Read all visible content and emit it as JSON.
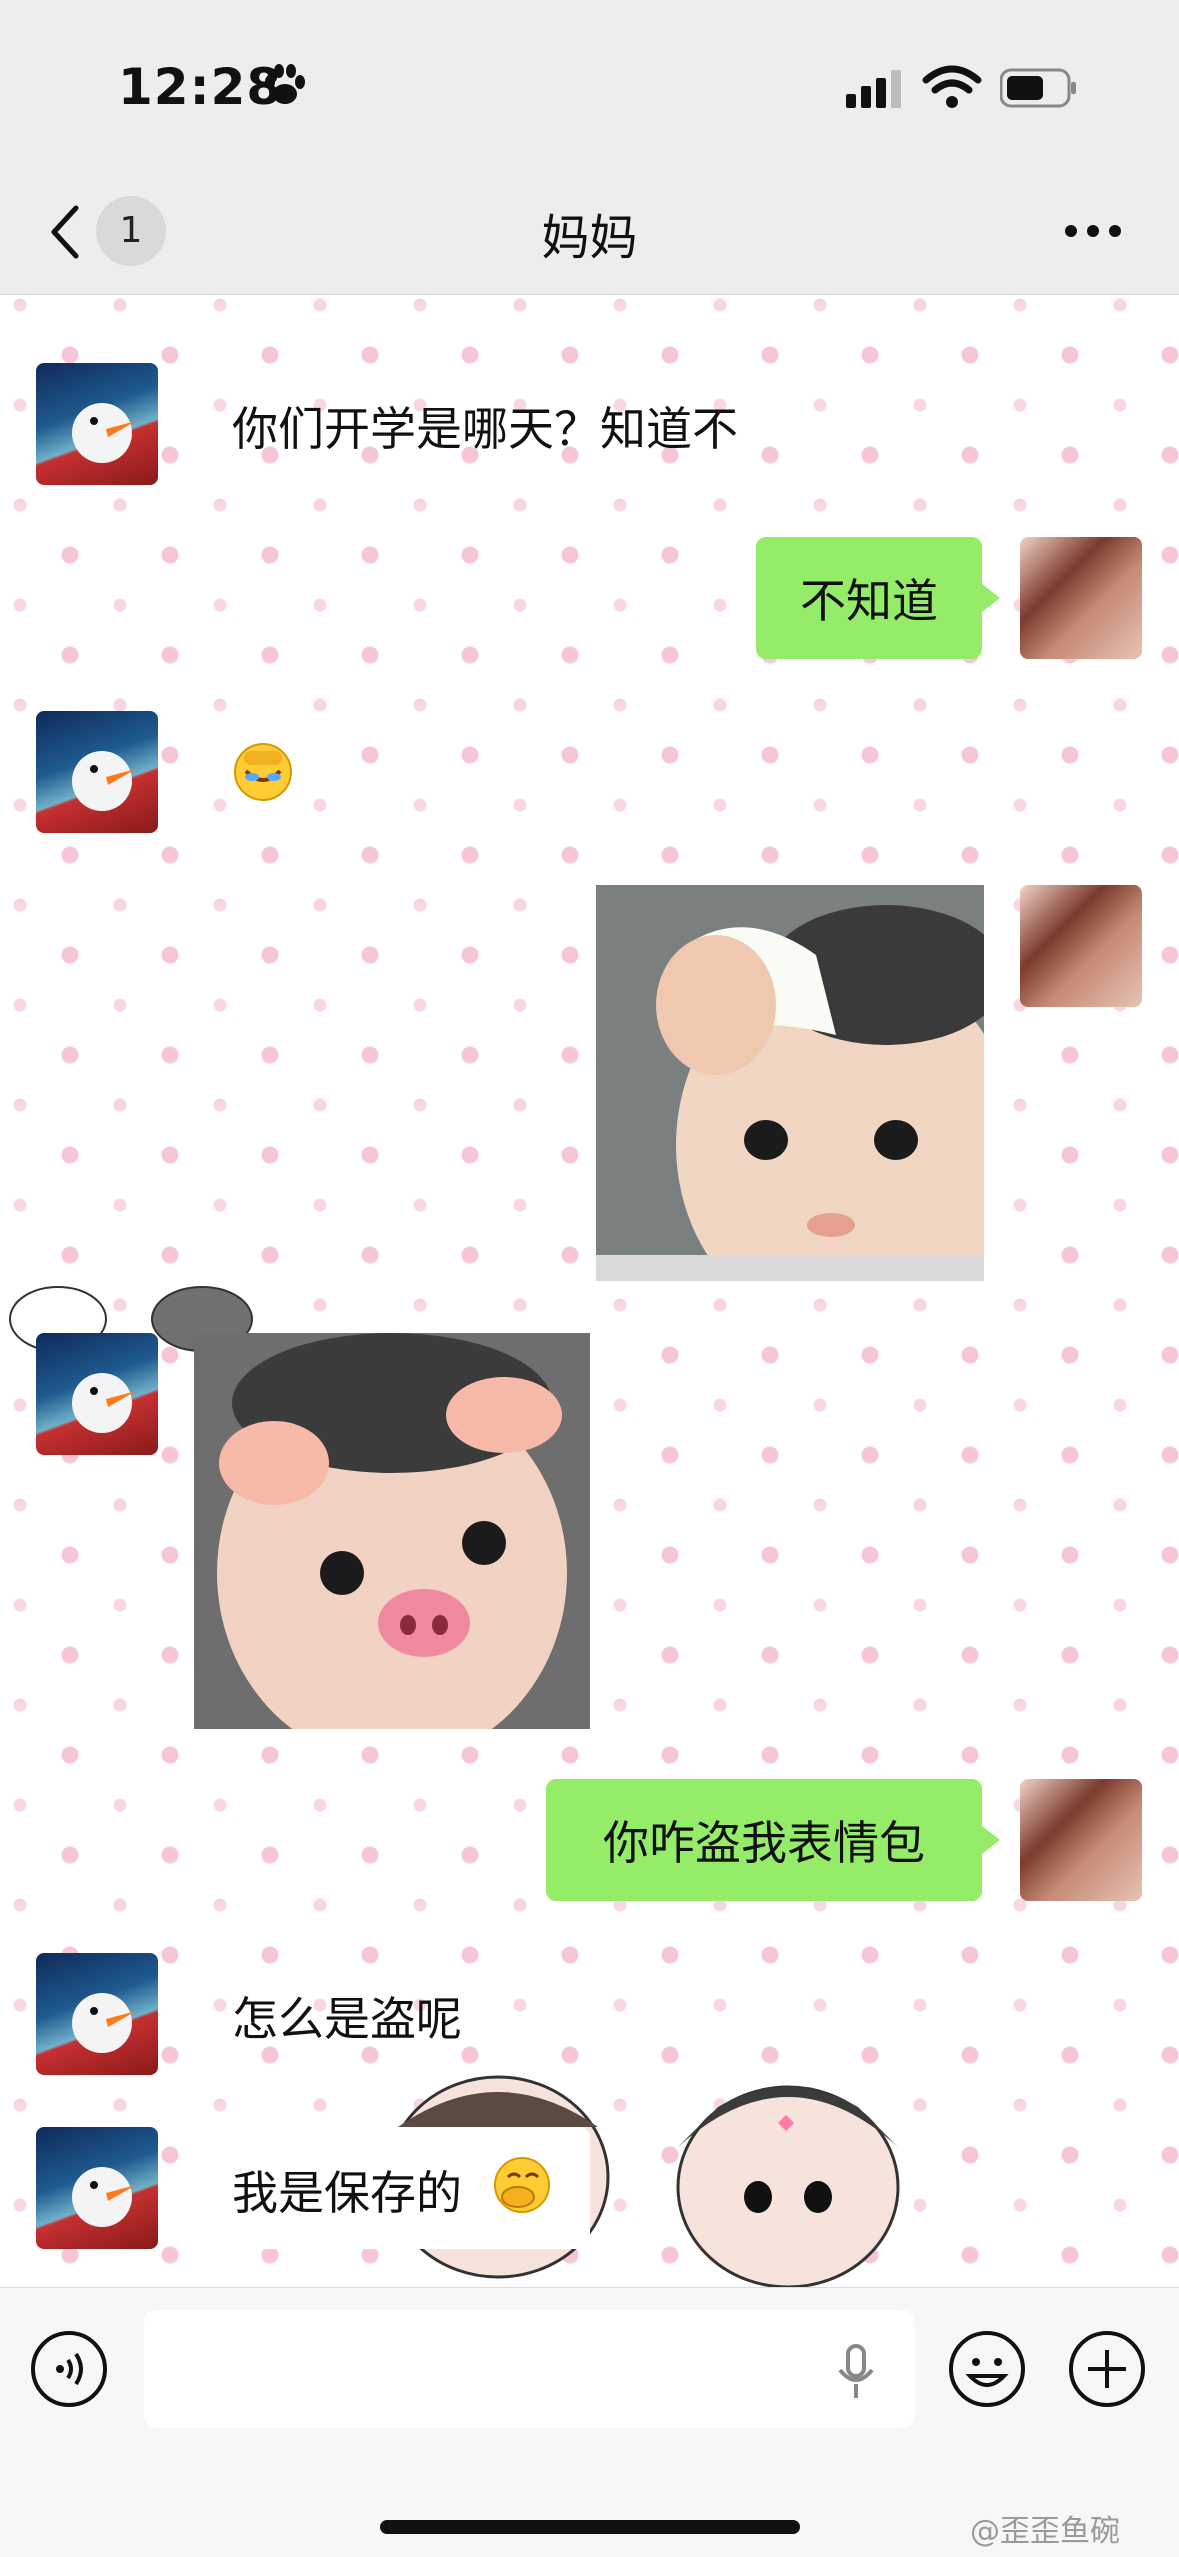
{
  "status": {
    "time": "12:28"
  },
  "nav": {
    "back_count": "1",
    "title": "妈妈"
  },
  "messages": {
    "m1": "你们开学是哪天？知道不",
    "m2": "不知道",
    "m4": "你咋盗我表情包",
    "m5": "怎么是盗呢",
    "m6": "我是保存的"
  },
  "watermark": "@歪歪鱼碗",
  "colors": {
    "bubble_green": "#95ec69",
    "background": "#ededed",
    "wallpaper_dot": "#f6c6d8"
  }
}
